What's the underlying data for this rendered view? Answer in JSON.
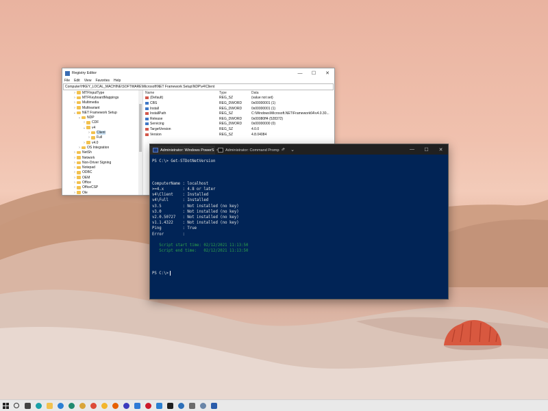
{
  "registry_editor": {
    "title": "Registry Editor",
    "window_controls": [
      "—",
      "☐",
      "✕"
    ],
    "menu": [
      "File",
      "Edit",
      "View",
      "Favorites",
      "Help"
    ],
    "address": "Computer\\HKEY_LOCAL_MACHINE\\SOFTWARE\\Microsoft\\NET Framework Setup\\NDP\\v4\\Client",
    "tree": [
      {
        "label": "MTFInputType",
        "level": 1,
        "chevron": "›"
      },
      {
        "label": "MTFKeyboardMappings",
        "level": 1,
        "chevron": "›"
      },
      {
        "label": "Multimedia",
        "level": 1,
        "chevron": "›"
      },
      {
        "label": "Multivariant",
        "level": 1,
        "chevron": "›"
      },
      {
        "label": "NET Framework Setup",
        "level": 1,
        "chevron": "⌄"
      },
      {
        "label": "NDP",
        "level": 2,
        "chevron": "⌄"
      },
      {
        "label": "CDF",
        "level": 3,
        "chevron": "›"
      },
      {
        "label": "v4",
        "level": 3,
        "chevron": "⌄"
      },
      {
        "label": "Client",
        "level": 4,
        "chevron": "›",
        "selected": true
      },
      {
        "label": "Full",
        "level": 4,
        "chevron": "›"
      },
      {
        "label": "v4.0",
        "level": 3,
        "chevron": "›"
      },
      {
        "label": "OS Integration",
        "level": 2,
        "chevron": "›"
      },
      {
        "label": "NetSh",
        "level": 1,
        "chevron": "›"
      },
      {
        "label": "Network",
        "level": 1,
        "chevron": "›"
      },
      {
        "label": "Non-Driver Signing",
        "level": 1,
        "chevron": "›"
      },
      {
        "label": "Notepad",
        "level": 1,
        "chevron": "›"
      },
      {
        "label": "ODBC",
        "level": 1,
        "chevron": "›"
      },
      {
        "label": "OEM",
        "level": 1,
        "chevron": "›"
      },
      {
        "label": "Office",
        "level": 1,
        "chevron": "›"
      },
      {
        "label": "OfficeCSP",
        "level": 1,
        "chevron": "›"
      },
      {
        "label": "Ole",
        "level": 1,
        "chevron": "›"
      }
    ],
    "columns": [
      "Name",
      "Type",
      "Data"
    ],
    "rows": [
      {
        "name": "(Default)",
        "type": "REG_SZ",
        "data": "(value not set)",
        "kind": "sz"
      },
      {
        "name": "CBS",
        "type": "REG_DWORD",
        "data": "0x00000001 (1)",
        "kind": "dw"
      },
      {
        "name": "Install",
        "type": "REG_DWORD",
        "data": "0x00000001 (1)",
        "kind": "dw"
      },
      {
        "name": "InstallPath",
        "type": "REG_SZ",
        "data": "C:\\Windows\\Microsoft.NET\\Framework64\\v4.0.30...",
        "kind": "sz"
      },
      {
        "name": "Release",
        "type": "REG_DWORD",
        "data": "0x00080ff4 (528372)",
        "kind": "dw"
      },
      {
        "name": "Servicing",
        "type": "REG_DWORD",
        "data": "0x00000000 (0)",
        "kind": "dw"
      },
      {
        "name": "TargetVersion",
        "type": "REG_SZ",
        "data": "4.0.0",
        "kind": "sz"
      },
      {
        "name": "Version",
        "type": "REG_SZ",
        "data": "4.8.04084",
        "kind": "sz"
      }
    ]
  },
  "terminal": {
    "tabs": [
      {
        "label": "Administrator: Windows PowerS",
        "active": true
      },
      {
        "label": "Administrator: Command Promp",
        "active": false
      }
    ],
    "tab_close": "×",
    "new_tab": "+",
    "dropdown": "⌄",
    "window_controls": [
      "—",
      "☐",
      "✕"
    ],
    "command_line": "PS C:\\> Get-STDotNetVersion",
    "output": [
      "ComputerName : localhost",
      ">=4.x        : 4.8 or later",
      "v4\\Client    : Installed",
      "v4\\Full      : Installed",
      "v3.5         : Not installed (no key)",
      "v3.0         : Not installed (no key)",
      "v2.0.50727   : Not installed (no key)",
      "v1.1.4322    : Not installed (no key)",
      "Ping         : True",
      "Error        :"
    ],
    "script_start": "   Script start time: 02/12/2021 11:13:50",
    "script_end": "   Script end time:   02/12/2021 11:13:50",
    "prompt": "PS C:\\>"
  },
  "taskbar": {
    "icons": [
      {
        "name": "start-icon",
        "color": "#222222"
      },
      {
        "name": "search-icon",
        "color": "#333333"
      },
      {
        "name": "settings-icon",
        "color": "#444444"
      },
      {
        "name": "edge-icon",
        "color": "#1aa0a8"
      },
      {
        "name": "file-explorer-icon",
        "color": "#f2c14e"
      },
      {
        "name": "edge-beta-icon",
        "color": "#2b7fd4"
      },
      {
        "name": "edge-dev-icon",
        "color": "#1f8a70"
      },
      {
        "name": "edge-canary-icon",
        "color": "#d9a53a"
      },
      {
        "name": "chrome-icon",
        "color": "#dd4b39"
      },
      {
        "name": "chrome-canary-icon",
        "color": "#f3b62c"
      },
      {
        "name": "firefox-icon",
        "color": "#e66000"
      },
      {
        "name": "firefox-nightly-icon",
        "color": "#3b3bbd"
      },
      {
        "name": "store-icon",
        "color": "#2f7bd6"
      },
      {
        "name": "opera-icon",
        "color": "#cc1a2b"
      },
      {
        "name": "vscode-icon",
        "color": "#2a7fd1"
      },
      {
        "name": "terminal-icon",
        "color": "#1e1e1e"
      },
      {
        "name": "photos-icon",
        "color": "#2c6fb8"
      },
      {
        "name": "mail-icon",
        "color": "#6b6b6b"
      },
      {
        "name": "cloud-icon",
        "color": "#6a86a8"
      },
      {
        "name": "powershell-icon",
        "color": "#2a5caa"
      }
    ]
  }
}
